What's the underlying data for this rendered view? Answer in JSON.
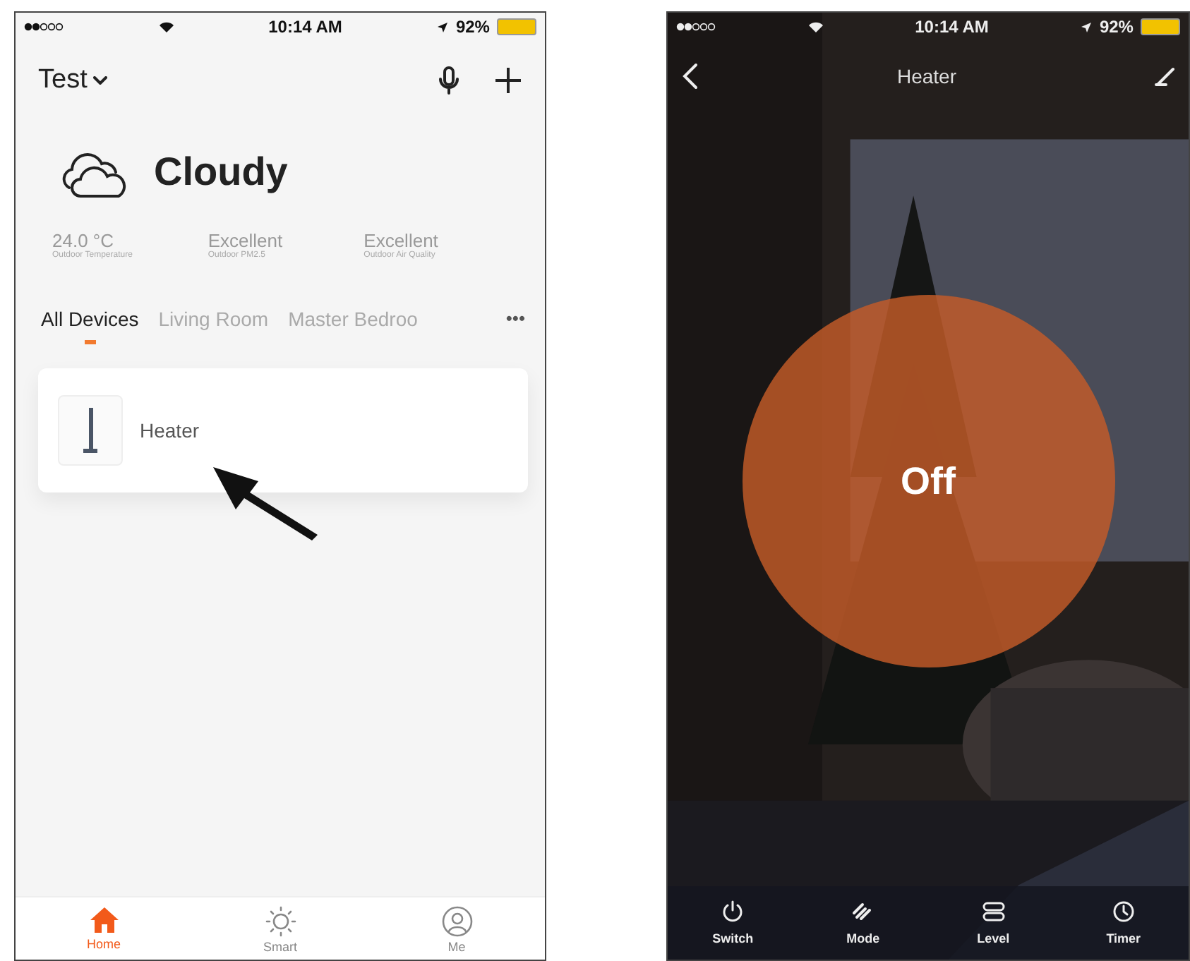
{
  "home_screen": {
    "status_bar": {
      "time": "10:14 AM",
      "battery": "92%"
    },
    "header": {
      "home_name": "Test"
    },
    "weather": {
      "condition": "Cloudy",
      "stats": [
        {
          "value": "24.0 °C",
          "label": "Outdoor Temperature"
        },
        {
          "value": "Excellent",
          "label": "Outdoor PM2.5"
        },
        {
          "value": "Excellent",
          "label": "Outdoor Air Quality"
        }
      ]
    },
    "room_tabs": [
      {
        "label": "All Devices",
        "selected": true
      },
      {
        "label": "Living Room",
        "selected": false
      },
      {
        "label": "Master Bedroo",
        "selected": false
      }
    ],
    "more": "•••",
    "devices": [
      {
        "name": "Heater"
      }
    ],
    "nav": [
      {
        "label": "Home",
        "selected": true
      },
      {
        "label": "Smart",
        "selected": false
      },
      {
        "label": "Me",
        "selected": false
      }
    ]
  },
  "device_screen": {
    "status_bar": {
      "time": "10:14 AM",
      "battery": "92%"
    },
    "title": "Heater",
    "power_state": "Off",
    "controls": [
      {
        "label": "Switch"
      },
      {
        "label": "Mode"
      },
      {
        "label": "Level"
      },
      {
        "label": "Timer"
      }
    ]
  }
}
